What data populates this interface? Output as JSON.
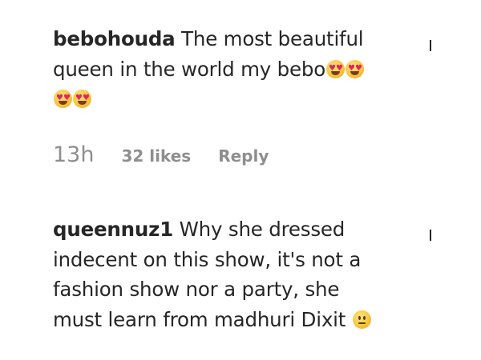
{
  "comments": [
    {
      "username": "bebohouda",
      "text_line1": " The most beautiful",
      "text_line2": "queen in the world my bebo",
      "emoji_line2": [
        "heart-eyes-emoji",
        "heart-eyes-emoji"
      ],
      "emoji_line3": [
        "heart-eyes-emoji",
        "heart-eyes-emoji"
      ],
      "time": "13h",
      "likes": "32 likes",
      "reply_label": "Reply"
    },
    {
      "username": "queennuz1",
      "text_line1": " Why she dressed",
      "text_line2": "indecent on this show, it's not a",
      "text_line3": "fashion show nor a party, she",
      "text_line4": "must learn from madhuri Dixit ",
      "emoji_line4": [
        "neutral-face-emoji"
      ]
    }
  ],
  "colors": {
    "text": "#262626",
    "meta": "#8e8e8e"
  }
}
